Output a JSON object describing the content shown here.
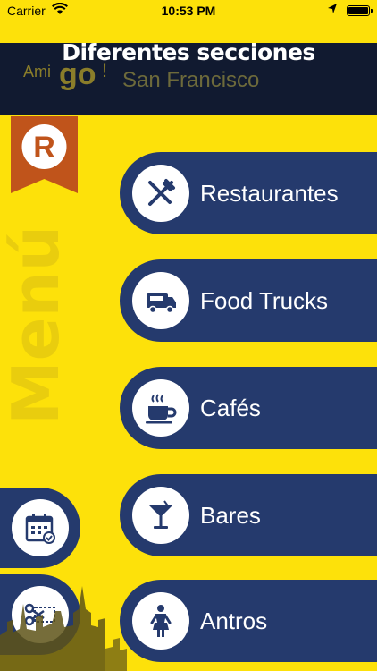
{
  "status_bar": {
    "carrier": "Carrier",
    "time": "10:53 PM"
  },
  "caption": "Diferentes secciones",
  "logo": {
    "ami": "Ami",
    "go": "go",
    "excl": "!",
    "city": "San Francisco"
  },
  "ribbon_letter": "R",
  "menu_word": "Menú",
  "categories": [
    {
      "label": "Restaurantes",
      "icon": "fork-knife-icon"
    },
    {
      "label": "Food Trucks",
      "icon": "food-truck-icon"
    },
    {
      "label": "Cafés",
      "icon": "coffee-cup-icon"
    },
    {
      "label": "Bares",
      "icon": "cocktail-glass-icon"
    },
    {
      "label": "Antros",
      "icon": "dancer-icon"
    }
  ],
  "side_tabs": [
    {
      "icon": "calendar-icon"
    },
    {
      "icon": "coupon-scissors-icon"
    }
  ],
  "colors": {
    "yellow": "#fde10a",
    "navy": "#253a6d",
    "header": "#111a30",
    "ribbon": "#c0541b"
  }
}
